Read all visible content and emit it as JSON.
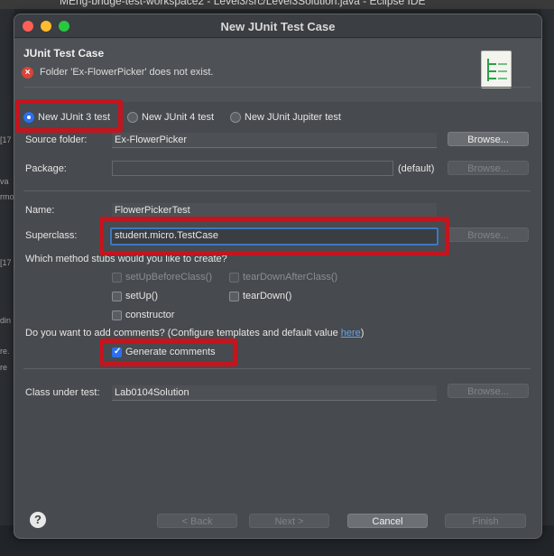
{
  "background": {
    "window_title": "MEng-bridge-test-workspace2 - Level3/src/Level3Solution.java - Eclipse IDE",
    "left_fragments": [
      "[17",
      "va",
      "rmo",
      "[17",
      "din",
      "re.",
      "re"
    ]
  },
  "dialog": {
    "title": "New JUnit Test Case",
    "header": {
      "title": "JUnit Test Case",
      "error_message": "Folder 'Ex-FlowerPicker' does not exist.",
      "error_icon": "error-icon"
    },
    "radios": [
      {
        "label": "New JUnit 3 test",
        "checked": true
      },
      {
        "label": "New JUnit 4 test",
        "checked": false
      },
      {
        "label": "New JUnit Jupiter test",
        "checked": false
      }
    ],
    "source_folder": {
      "label": "Source folder:",
      "value": "Ex-FlowerPicker",
      "browse": "Browse..."
    },
    "package": {
      "label": "Package:",
      "value": "",
      "suffix": "(default)",
      "browse": "Browse..."
    },
    "name": {
      "label": "Name:",
      "value": "FlowerPickerTest"
    },
    "superclass": {
      "label": "Superclass:",
      "value": "student.micro.TestCase",
      "browse": "Browse..."
    },
    "stubs": {
      "question": "Which method stubs would you like to create?",
      "items": [
        {
          "label": "setUpBeforeClass()",
          "checked": false,
          "enabled": false
        },
        {
          "label": "tearDownAfterClass()",
          "checked": false,
          "enabled": false
        },
        {
          "label": "setUp()",
          "checked": false,
          "enabled": true
        },
        {
          "label": "tearDown()",
          "checked": false,
          "enabled": true
        },
        {
          "label": "constructor",
          "checked": false,
          "enabled": true
        }
      ]
    },
    "comments": {
      "question": "Do you want to add comments? (Configure templates and default value ",
      "link": "here",
      "question_end": ")",
      "generate_label": "Generate comments",
      "checked": true
    },
    "class_under_test": {
      "label": "Class under test:",
      "value": "Lab0104Solution",
      "browse": "Browse..."
    },
    "footer": {
      "help": "?",
      "back": "< Back",
      "next": "Next >",
      "cancel": "Cancel",
      "finish": "Finish"
    },
    "colors": {
      "highlight": "#c4141e",
      "accent": "#2b6ff0",
      "link": "#6aa3e8",
      "error": "#d9443a"
    }
  }
}
